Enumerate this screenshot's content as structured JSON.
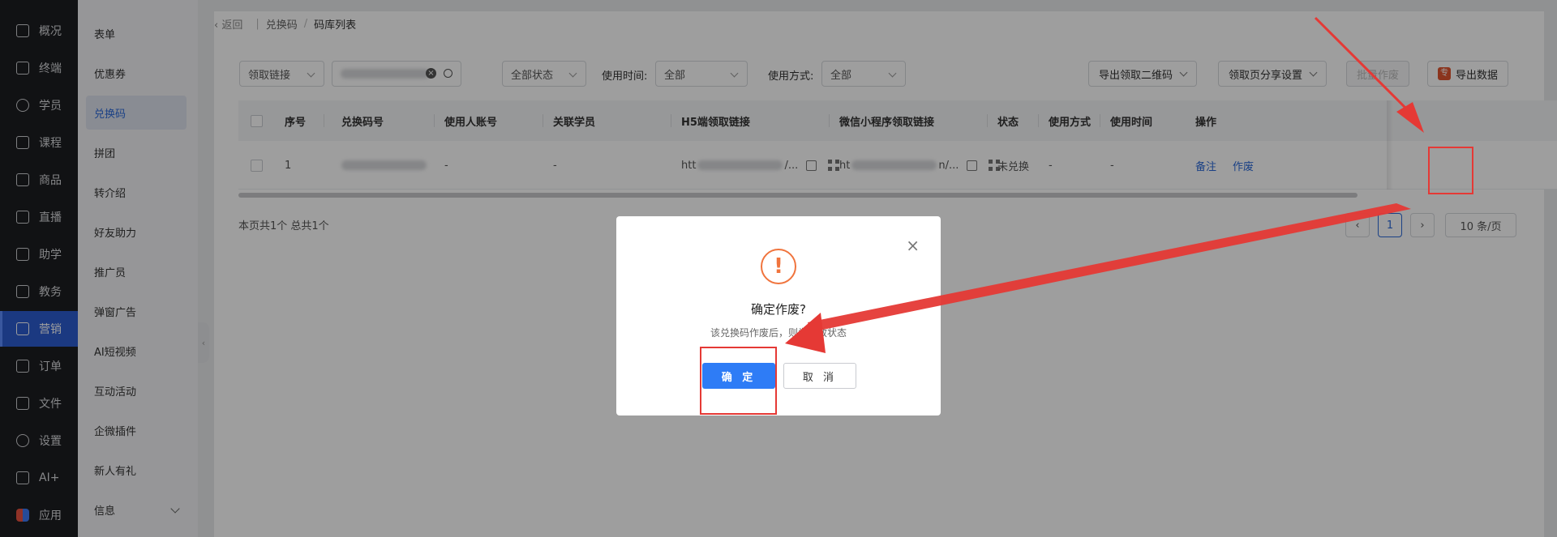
{
  "rail": {
    "items": [
      {
        "label": "概况",
        "icon": "dashboard-icon"
      },
      {
        "label": "终端",
        "icon": "terminal-icon"
      },
      {
        "label": "学员",
        "icon": "user-icon"
      },
      {
        "label": "课程",
        "icon": "course-icon"
      },
      {
        "label": "商品",
        "icon": "goods-icon"
      },
      {
        "label": "直播",
        "icon": "live-icon"
      },
      {
        "label": "助学",
        "icon": "study-icon"
      },
      {
        "label": "教务",
        "icon": "academic-icon"
      },
      {
        "label": "营销",
        "icon": "marketing-icon"
      },
      {
        "label": "订单",
        "icon": "order-icon"
      },
      {
        "label": "文件",
        "icon": "folder-icon"
      },
      {
        "label": "设置",
        "icon": "settings-icon"
      },
      {
        "label": "AI+",
        "icon": "ai-icon"
      },
      {
        "label": "应用",
        "icon": "apps-icon"
      }
    ]
  },
  "sidebar": {
    "items": [
      "表单",
      "优惠券",
      "兑换码",
      "拼团",
      "转介绍",
      "好友助力",
      "推广员",
      "弹窗广告",
      "AI短视频",
      "互动活动",
      "企微插件",
      "新人有礼",
      "信息"
    ]
  },
  "breadcrumb": {
    "back": "返回",
    "level1": "兑换码",
    "sep": "/",
    "current": "码库列表"
  },
  "toolbar": {
    "link_select": "领取链接",
    "status_select": "全部状态",
    "use_time_label": "使用时间:",
    "use_time_value": "全部",
    "use_method_label": "使用方式:",
    "use_method_value": "全部",
    "export_qr": "导出领取二维码",
    "share_settings": "领取页分享设置",
    "batch_void": "批量作废",
    "export_data": "导出数据"
  },
  "table": {
    "headers": [
      "序号",
      "兑换码号",
      "使用人账号",
      "关联学员",
      "H5端领取链接",
      "微信小程序领取链接",
      "状态",
      "使用方式",
      "使用时间",
      "操作"
    ],
    "rows": [
      {
        "index": "1",
        "user": "-",
        "student": "-",
        "h5_prefix": "htt",
        "h5_suffix": "/...",
        "mp_prefix": "ht",
        "mp_suffix": "n/...",
        "status": "未兑换",
        "method": "-",
        "time": "-",
        "action_note": "备注",
        "action_void": "作废"
      }
    ]
  },
  "footer": {
    "summary": "本页共1个 总共1个",
    "current_page": "1",
    "page_size": "10 条/页"
  },
  "modal": {
    "icon_glyph": "!",
    "title": "确定作废?",
    "desc": "该兑换码作废后，则为失效状态",
    "confirm": "确 定",
    "cancel": "取 消",
    "close_glyph": "×"
  },
  "colors": {
    "primary": "#2e7cf6",
    "warning": "#f0743d",
    "annotation": "#e53935",
    "rail_bg": "#1c1d21"
  }
}
